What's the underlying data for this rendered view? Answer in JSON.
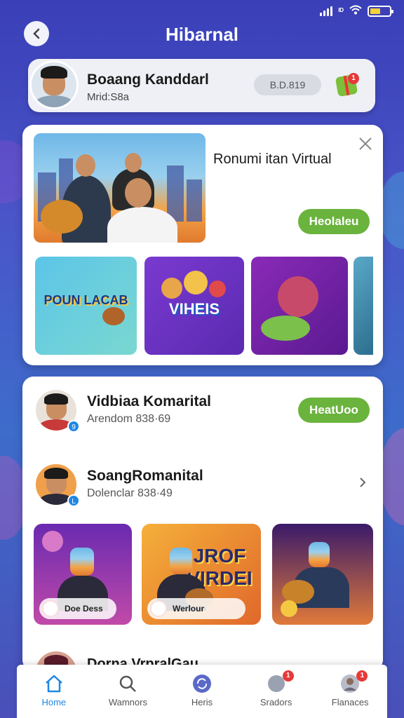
{
  "status": {
    "carrier": "ᴵᴰ",
    "wifi": "◠"
  },
  "header": {
    "title": "Hibarnal"
  },
  "profile": {
    "name": "Boaang Kanddarl",
    "subtitle": "Mrid:S8a",
    "code": "B.D.819",
    "gift_badge": "1"
  },
  "featured": {
    "title": "Ronumi itan Virtual",
    "button": "Heolaleu",
    "thumbnails": [
      {
        "label": "POUN LACAB"
      },
      {
        "label": "VIHEIS"
      },
      {
        "label": ""
      },
      {
        "label": ""
      }
    ]
  },
  "list": {
    "rows": [
      {
        "name": "Vidbiaa Komarital",
        "subtitle": "Arendom 838·69",
        "badge": "9",
        "button": "HeatUoo"
      },
      {
        "name": "SoangRomanital",
        "subtitle": "Dolenclar 838·49",
        "badge": "L"
      }
    ],
    "videos": [
      {
        "caption": "Doe Dess",
        "text": ""
      },
      {
        "caption": "Werlour",
        "text": "JROF VIRDEI"
      },
      {
        "caption": "",
        "text": ""
      }
    ],
    "partial_name": "Dorna VrpralGau"
  },
  "tabs": [
    {
      "label": "Home",
      "active": true
    },
    {
      "label": "Wamnors"
    },
    {
      "label": "Heris"
    },
    {
      "label": "Sradors",
      "badge": "1"
    },
    {
      "label": "Flanaces",
      "badge": "1"
    }
  ],
  "colors": {
    "accent": "#6ab33d",
    "active_tab": "#1e88e5",
    "background": "#3a3fb8"
  }
}
